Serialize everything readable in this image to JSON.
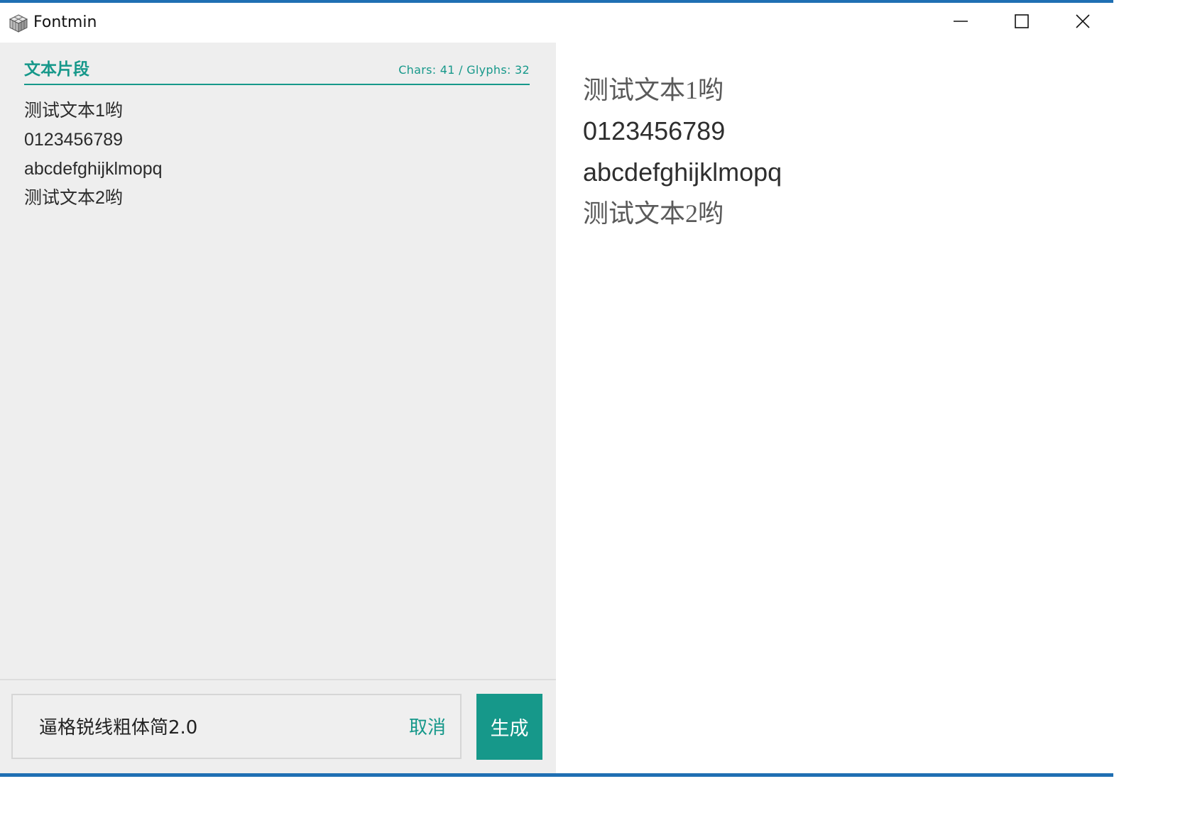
{
  "window": {
    "title": "Fontmin",
    "icon": "font-cube-icon",
    "controls": {
      "minimize_icon": "minimize-icon",
      "maximize_icon": "maximize-icon",
      "close_icon": "close-icon"
    },
    "accent_color": "#1f6fb3"
  },
  "left_panel": {
    "section_title": "文本片段",
    "stats": "Chars: 41 / Glyphs: 32",
    "text_lines": [
      "测试文本1哟",
      "0123456789",
      "abcdefghijklmopq",
      "测试文本2哟"
    ]
  },
  "bottom_bar": {
    "font_name": "逼格锐线粗体简2.0",
    "cancel_label": "取消",
    "generate_label": "生成"
  },
  "preview": {
    "lines": [
      "测试文本1哟",
      "0123456789",
      "abcdefghijklmopq",
      "测试文本2哟"
    ]
  },
  "colors": {
    "brand": "#16988a",
    "left_panel_bg": "#eeeeee",
    "preview_bg": "#ffffff"
  }
}
